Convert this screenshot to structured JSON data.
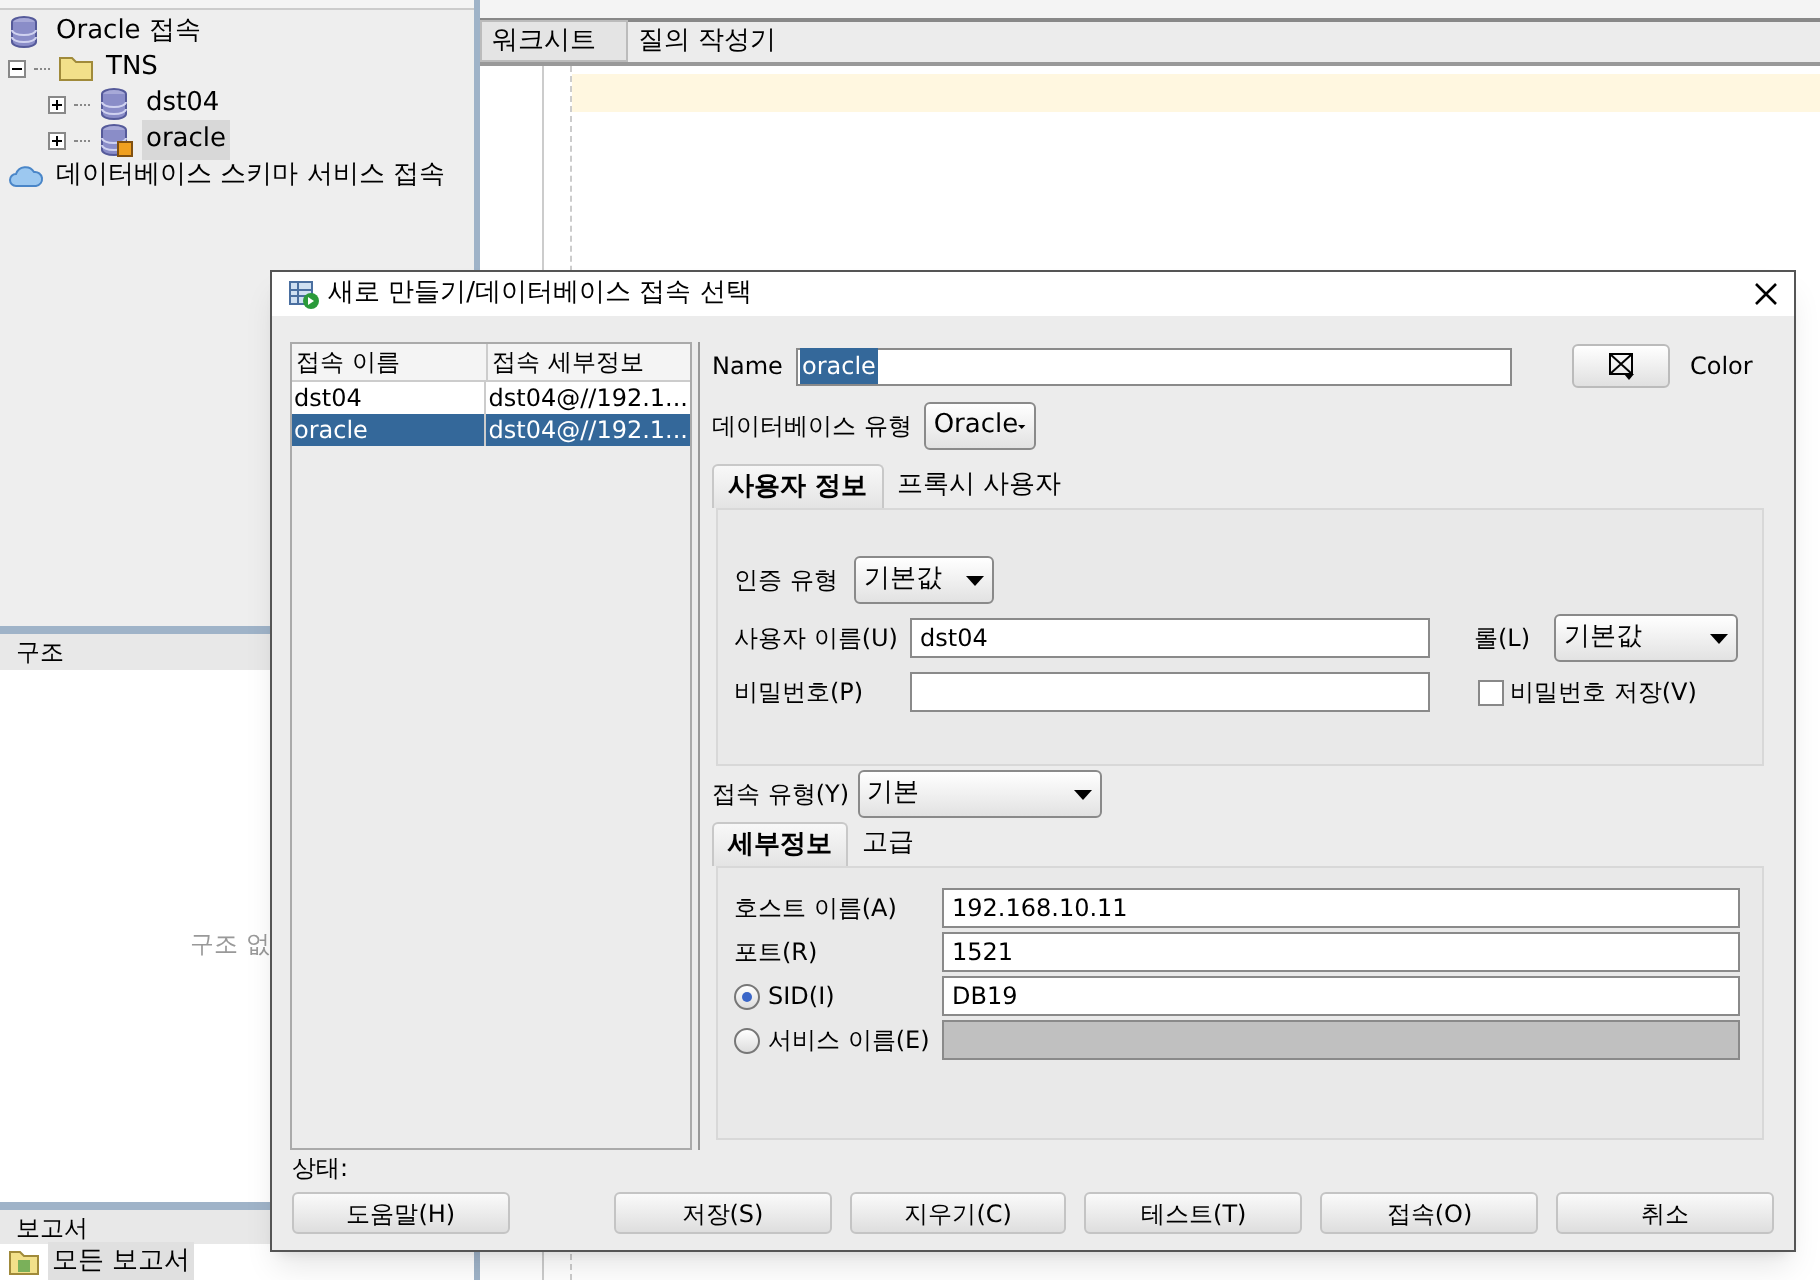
{
  "navigator": {
    "items": [
      {
        "label": "Oracle 접속",
        "kind": "database",
        "selected": false,
        "children": [
          {
            "label": "TNS",
            "kind": "folder",
            "expanded": true,
            "selected": false,
            "children": [
              {
                "label": "dst04",
                "kind": "database",
                "expanded": false,
                "selected": false
              },
              {
                "label": "oracle",
                "kind": "connection",
                "expanded": false,
                "selected": true
              }
            ]
          }
        ]
      },
      {
        "label": "데이터베이스 스키마 서비스 접속",
        "kind": "cloud",
        "selected": false
      }
    ]
  },
  "editor_tabs": [
    {
      "label": "워크시트",
      "selected": true
    },
    {
      "label": "질의 작성기",
      "selected": false
    }
  ],
  "structure_panel": {
    "title": "구조",
    "message": "구조 없"
  },
  "reports_panel": {
    "title": "보고서",
    "items": [
      {
        "label": "모든 보고서"
      }
    ]
  },
  "dialog": {
    "title": "새로 만들기/데이터베이스 접속 선택",
    "table": {
      "columns": [
        "접속 이름",
        "접속 세부정보"
      ],
      "rows": [
        {
          "cells": [
            "dst04",
            "dst04@//192.1..."
          ],
          "selected": false
        },
        {
          "cells": [
            "oracle",
            "dst04@//192.1..."
          ],
          "selected": true
        }
      ]
    },
    "name": {
      "label": "Name",
      "value": "oracle"
    },
    "color_label": "Color",
    "db_type": {
      "label": "데이터베이스 유형",
      "value": "Oracle"
    },
    "tabs": [
      {
        "label": "사용자 정보",
        "selected": true
      },
      {
        "label": "프록시 사용자",
        "selected": false
      }
    ],
    "auth_type": {
      "label": "인증 유형",
      "value": "기본값"
    },
    "username": {
      "label": "사용자 이름(U)",
      "value": "dst04"
    },
    "role": {
      "label": "롤(L)",
      "value": "기본값"
    },
    "password": {
      "label": "비밀번호(P)"
    },
    "save_password": {
      "label": "비밀번호 저장(V)",
      "checked": false
    },
    "connection_type": {
      "label": "접속 유형(Y)",
      "value": "기본"
    },
    "detail_tabs": [
      {
        "label": "세부정보",
        "selected": true
      },
      {
        "label": "고급",
        "selected": false
      }
    ],
    "host": {
      "label": "호스트 이름(A)",
      "value": "192.168.10.11"
    },
    "port": {
      "label": "포트(R)",
      "value": "1521"
    },
    "sid": {
      "label": "SID(I)",
      "value": "DB19",
      "selected": true
    },
    "service_name": {
      "label": "서비스 이름(E)",
      "selected": false
    },
    "status_label": "상태:",
    "buttons": [
      "도움말(H)",
      "저장(S)",
      "지우기(C)",
      "테스트(T)",
      "접속(O)",
      "취소"
    ]
  }
}
